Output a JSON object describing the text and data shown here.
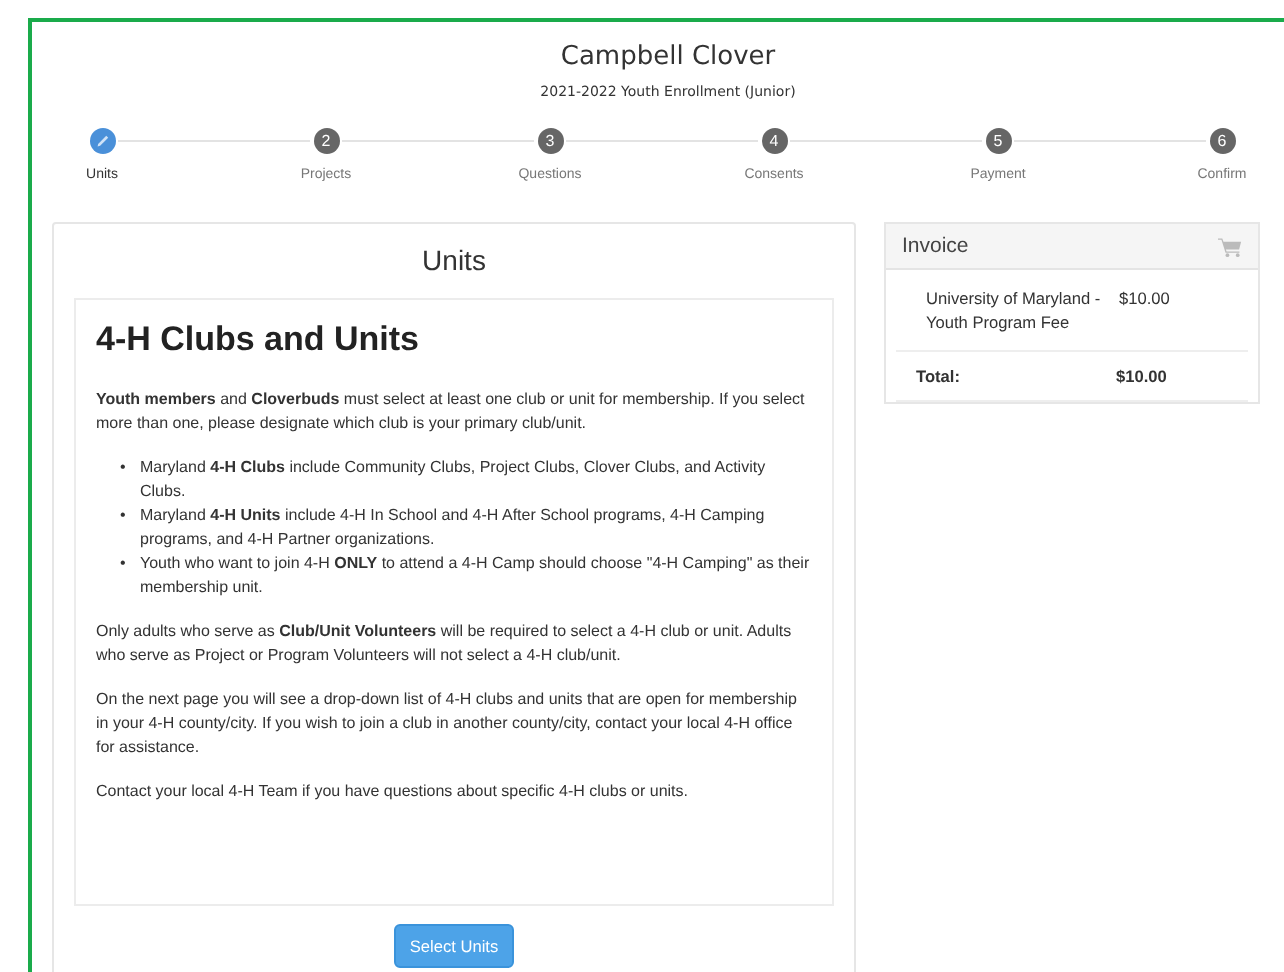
{
  "header": {
    "title": "Campbell Clover",
    "subtitle": "2021-2022 Youth Enrollment (Junior)"
  },
  "steps": [
    {
      "kind": "edit",
      "label": "Units",
      "selected": true
    },
    {
      "kind": "number",
      "number": "2",
      "label": "Projects",
      "selected": false
    },
    {
      "kind": "number",
      "number": "3",
      "label": "Questions",
      "selected": false
    },
    {
      "kind": "number",
      "number": "4",
      "label": "Consents",
      "selected": false
    },
    {
      "kind": "number",
      "number": "5",
      "label": "Payment",
      "selected": false
    },
    {
      "kind": "number",
      "number": "6",
      "label": "Confirm",
      "selected": false
    }
  ],
  "units_panel": {
    "title": "Units",
    "heading": "4-H Clubs and Units",
    "intro": "**Youth members** and **Cloverbuds** must select at least one club or unit for membership.  If you select more than one, please designate which club is your primary club/unit.",
    "bullets": [
      {
        "marker": "•",
        "text": "Maryland **4-H Clubs** include Community Clubs, Project Clubs, Clover Clubs, and Activity Clubs."
      },
      {
        "marker": "•",
        "text": "Maryland **4-H Units** include 4-H In School and 4-H After School programs, 4-H Camping programs, and 4-H Partner organizations."
      },
      {
        "marker": "•",
        "text": "Youth who want to join 4-H **ONLY** to attend a 4-H Camp should choose \"4-H Camping\" as their membership unit."
      }
    ],
    "paragraphs": [
      "Only adults who serve as **Club/Unit Volunteers** will be required to select a 4-H club or unit.  Adults who serve as Project or Program Volunteers will not select a 4-H club/unit.",
      "On the next page you will see a drop-down list of 4-H clubs and units that are open for membership in your 4-H county/city.  If you wish to join a club in another county/city, contact your local 4-H office for assistance.",
      "Contact your local 4-H Team if you have questions about specific 4-H clubs or units."
    ],
    "button": "Select Units"
  },
  "invoice": {
    "title": "Invoice",
    "items": [
      {
        "description": "University of Maryland - Youth Program Fee",
        "amount": "$10.00"
      }
    ],
    "total_label": "Total:",
    "total": "$10.00"
  }
}
